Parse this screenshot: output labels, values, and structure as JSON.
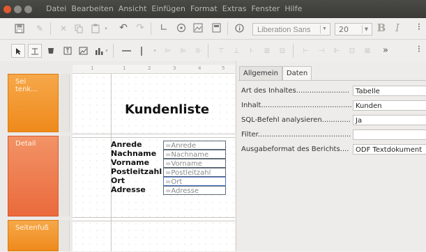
{
  "menu": [
    "Datei",
    "Bearbeiten",
    "Ansicht",
    "Einfügen",
    "Format",
    "Extras",
    "Fenster",
    "Hilfe"
  ],
  "toolbar": {
    "font_name": "Liberation Sans",
    "font_size": "20",
    "bold_label": "B",
    "italic_label": "I",
    "more_label": "»"
  },
  "sections": {
    "header": "Sei\ntenk...",
    "detail": "Detail",
    "footer": "Seitenfuß"
  },
  "ruler": {
    "ticks": [
      "1",
      "1",
      "2",
      "3",
      "4",
      "5"
    ]
  },
  "report": {
    "title": "Kundenliste",
    "rows": [
      {
        "label": "Anrede",
        "field": "=Anrede"
      },
      {
        "label": "Nachname",
        "field": "=Nachname"
      },
      {
        "label": "Vorname",
        "field": "=Vorname"
      },
      {
        "label": "Postleitzahl",
        "field": "=Postleitzahl"
      },
      {
        "label": "Ort",
        "field": "=Ort"
      },
      {
        "label": "Adresse",
        "field": "=Adresse"
      }
    ]
  },
  "properties": {
    "tabs": [
      "Allgemein",
      "Daten"
    ],
    "active_tab": "Daten",
    "rows": [
      {
        "label": "Art des Inhaltes........................",
        "value": "Tabelle"
      },
      {
        "label": "Inhalt.............................................",
        "value": "Kunden"
      },
      {
        "label": "SQL-Befehl analysieren..............",
        "value": "Ja"
      },
      {
        "label": "Filter.............................................",
        "value": ""
      },
      {
        "label": "Ausgabeformat des Berichts....",
        "value": "ODF Textdokument"
      }
    ]
  }
}
